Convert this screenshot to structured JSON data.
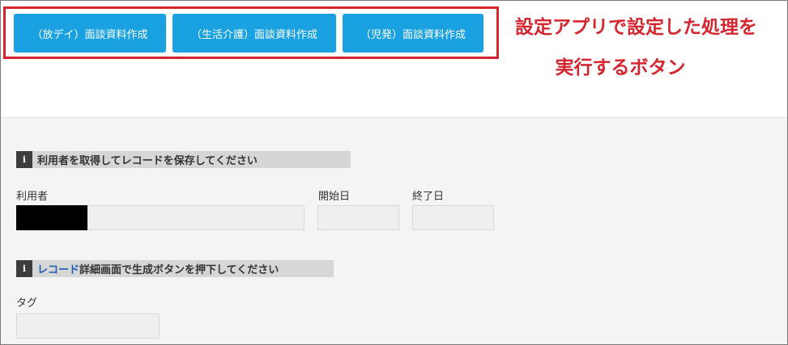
{
  "buttons": {
    "hoday": "（放デイ）面談資料作成",
    "seikatsu": "（生活介護）面談資料作成",
    "jihatsu": "（児発）面談資料作成"
  },
  "annotation": {
    "line1": "設定アプリで設定した処理を",
    "line2": "実行するボタン",
    "color": "#d5262f"
  },
  "section1": {
    "icon": "info-icon",
    "label": "利用者を取得してレコードを保存してください"
  },
  "fields": {
    "user_label": "利用者",
    "start_label": "開始日",
    "end_label": "終了日",
    "user_value": "",
    "start_value": "",
    "end_value": ""
  },
  "section2": {
    "icon": "info-icon",
    "label_highlight": "レコード",
    "label_rest": "詳細画面で生成ボタンを押下してください"
  },
  "tag": {
    "label": "タグ",
    "value": ""
  },
  "colors": {
    "accent": "#1aa1e1",
    "annotation": "#d5262f"
  }
}
